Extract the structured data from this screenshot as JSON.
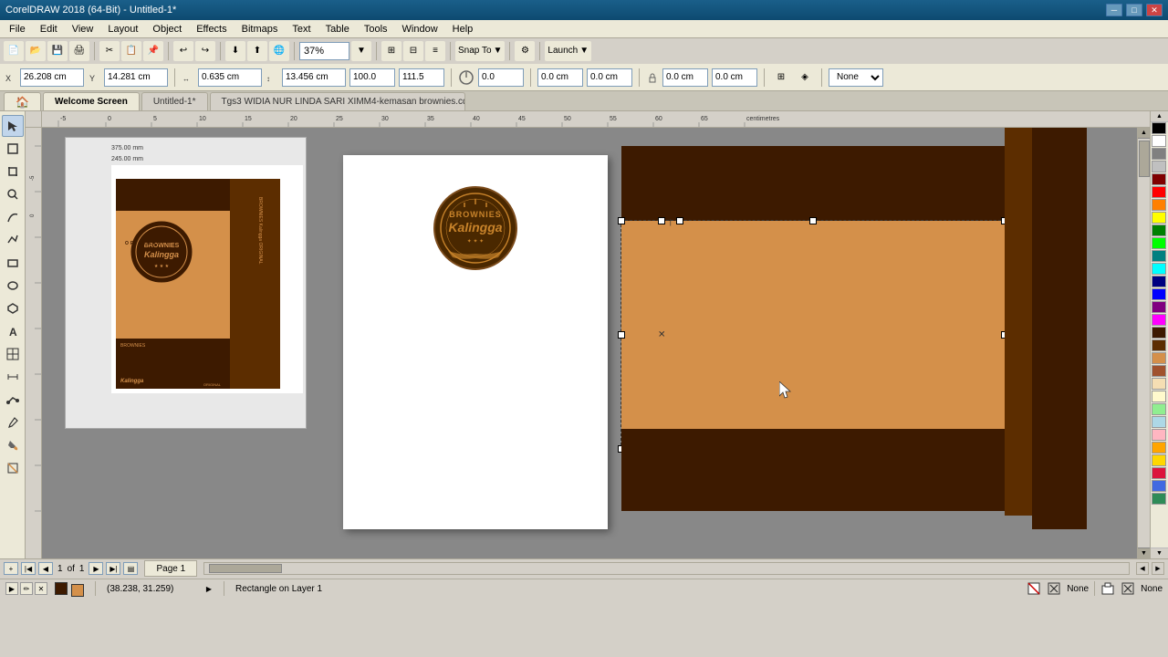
{
  "titlebar": {
    "title": "CorelDRAW 2018 (64-Bit) - Untitled-1*",
    "minimize": "─",
    "restore": "□",
    "close": "✕"
  },
  "menubar": {
    "items": [
      "File",
      "Edit",
      "View",
      "Layout",
      "Object",
      "Effects",
      "Bitmaps",
      "Text",
      "Table",
      "Tools",
      "Window",
      "Help"
    ]
  },
  "toolbar1": {
    "zoom_value": "37%",
    "snap_to": "Snap To",
    "launch": "Launch"
  },
  "propbar": {
    "x_label": "X:",
    "x_value": "26.208 cm",
    "y_label": "Y:",
    "y_value": "14.281 cm",
    "w_label": "W:",
    "w_value": "0.635 cm",
    "h_label": "H:",
    "h_value": "13.456 cm",
    "scale_w": "100.0",
    "scale_h": "111.5",
    "angle": "0.0",
    "pos_x": "0.0 cm",
    "pos_y": "0.0 cm",
    "move_x": "0.0 cm",
    "move_y": "0.0 cm",
    "none_label": "None"
  },
  "tabs": {
    "home_icon": "🏠",
    "welcome": "Welcome Screen",
    "untitled": "Untitled-1*",
    "cdr_file": "Tgs3 WIDIA NUR LINDA SARI XIMM4-kemasan brownies.cdr*"
  },
  "tools": {
    "items": [
      "↖",
      "⬡",
      "◻",
      "✏",
      "🖊",
      "✂",
      "🔠",
      "≡",
      "⊕",
      "◎",
      "➜",
      "🎨",
      "✱",
      "🔎"
    ]
  },
  "canvas": {
    "bg_color": "#808080"
  },
  "design": {
    "dark_brown": "#3d1a00",
    "mid_brown": "#5c2d00",
    "tan": "#d4904a",
    "text_original": "ORIGINAL",
    "text_brownies": "BROWNIES",
    "text_kalingga": "Kalingga",
    "logo_text_top": "BROWNIES",
    "logo_text_sub": "Kalingga"
  },
  "preview": {
    "dim1": "375.00 mm",
    "dim2": "245.00 mm"
  },
  "status": {
    "coords": "(38.238, 31.259)",
    "info": "Rectangle on Layer 1",
    "fill_label": "None",
    "outline_label": "None",
    "page": "1",
    "of": "of",
    "total": "1",
    "page_label": "Page 1"
  },
  "colors": {
    "palette": [
      "#000000",
      "#ffffff",
      "#808080",
      "#c0c0c0",
      "#800000",
      "#ff0000",
      "#ff8000",
      "#ffff00",
      "#008000",
      "#00ff00",
      "#008080",
      "#00ffff",
      "#000080",
      "#0000ff",
      "#800080",
      "#ff00ff",
      "#3d1a00",
      "#5c2d00",
      "#d4904a",
      "#a0522d",
      "#f5deb3",
      "#fffacd",
      "#90ee90",
      "#add8e6",
      "#ffb6c1",
      "#ffa500",
      "#ffd700",
      "#dc143c",
      "#4169e1",
      "#2e8b57"
    ]
  }
}
